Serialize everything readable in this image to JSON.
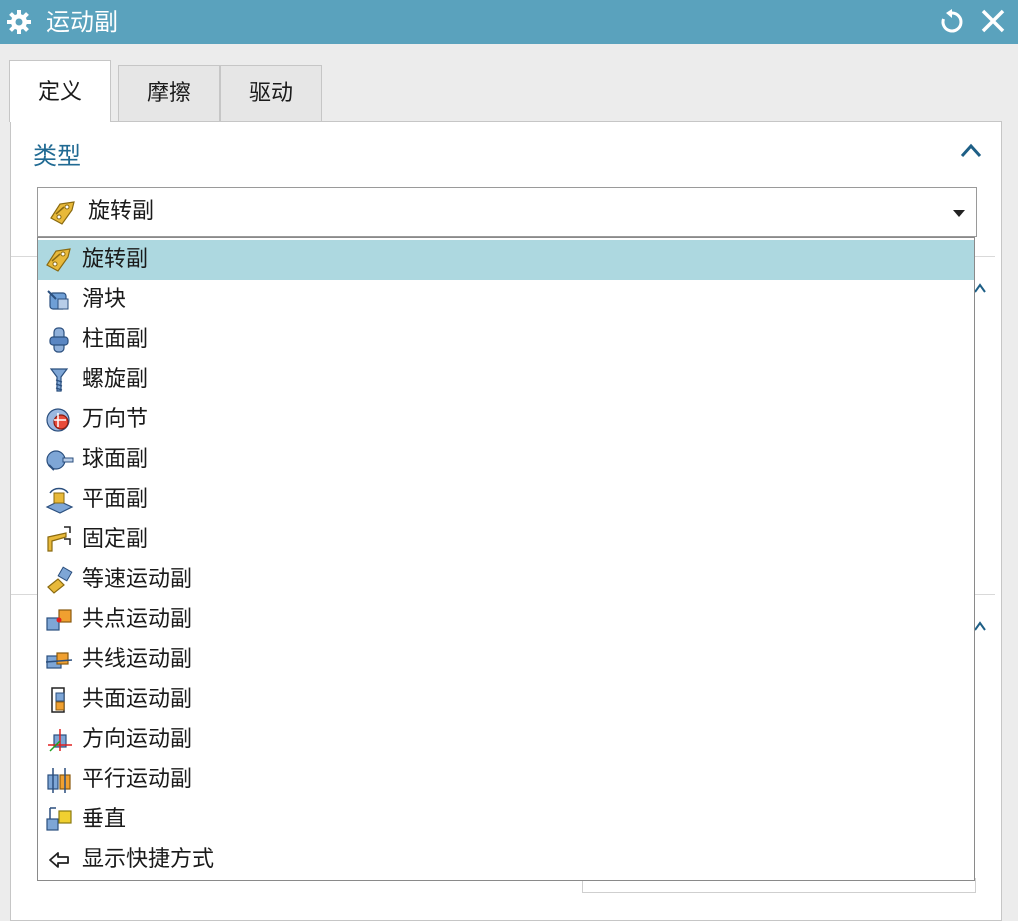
{
  "window": {
    "title": "运动副",
    "settings_icon": "gear-icon",
    "reset_icon": "reset-icon",
    "close_icon": "close-icon"
  },
  "tabs": [
    {
      "label": "定义",
      "active": true
    },
    {
      "label": "摩擦",
      "active": false
    },
    {
      "label": "驱动",
      "active": false
    }
  ],
  "type_section": {
    "title": "类型",
    "collapse_icon": "chevron-up-icon",
    "combo": {
      "value": "旋转副",
      "icon": "revolute-joint-icon",
      "arrow_icon": "caret-down-icon"
    }
  },
  "dropdown": {
    "selected": "旋转副",
    "items": [
      {
        "label": "旋转副",
        "icon": "revolute-joint-icon"
      },
      {
        "label": "滑块",
        "icon": "slider-joint-icon"
      },
      {
        "label": "柱面副",
        "icon": "cylindrical-joint-icon"
      },
      {
        "label": "螺旋副",
        "icon": "screw-joint-icon"
      },
      {
        "label": "万向节",
        "icon": "universal-joint-icon"
      },
      {
        "label": "球面副",
        "icon": "spherical-joint-icon"
      },
      {
        "label": "平面副",
        "icon": "planar-joint-icon"
      },
      {
        "label": "固定副",
        "icon": "fixed-joint-icon"
      },
      {
        "label": "等速运动副",
        "icon": "constant-velocity-joint-icon"
      },
      {
        "label": "共点运动副",
        "icon": "coincident-point-joint-icon"
      },
      {
        "label": "共线运动副",
        "icon": "coincident-line-joint-icon"
      },
      {
        "label": "共面运动副",
        "icon": "coplanar-joint-icon"
      },
      {
        "label": "方向运动副",
        "icon": "orientation-joint-icon"
      },
      {
        "label": "平行运动副",
        "icon": "parallel-joint-icon"
      },
      {
        "label": "垂直",
        "icon": "perpendicular-joint-icon"
      },
      {
        "label": "显示快捷方式",
        "icon": "arrow-left-icon"
      }
    ]
  },
  "colors": {
    "titlebar": "#5aa2bd",
    "section_title": "#206a93",
    "selection": "#add8e0"
  }
}
